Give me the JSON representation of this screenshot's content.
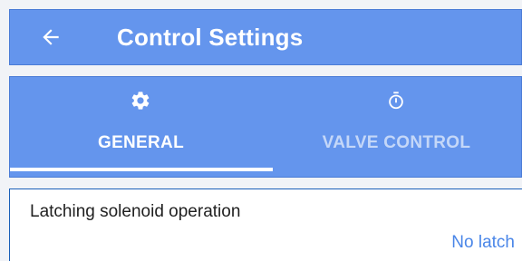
{
  "header": {
    "title": "Control Settings",
    "back_icon": "arrow-left-icon"
  },
  "tabs": [
    {
      "label": "GENERAL",
      "icon": "gear-icon",
      "active": true
    },
    {
      "label": "VALVE CONTROL",
      "icon": "stopwatch-icon",
      "active": false
    }
  ],
  "settings": {
    "latching": {
      "label": "Latching solenoid operation",
      "value": "No latch"
    }
  },
  "colors": {
    "primary": "#6495ed",
    "accent_text": "#4a86e8"
  }
}
